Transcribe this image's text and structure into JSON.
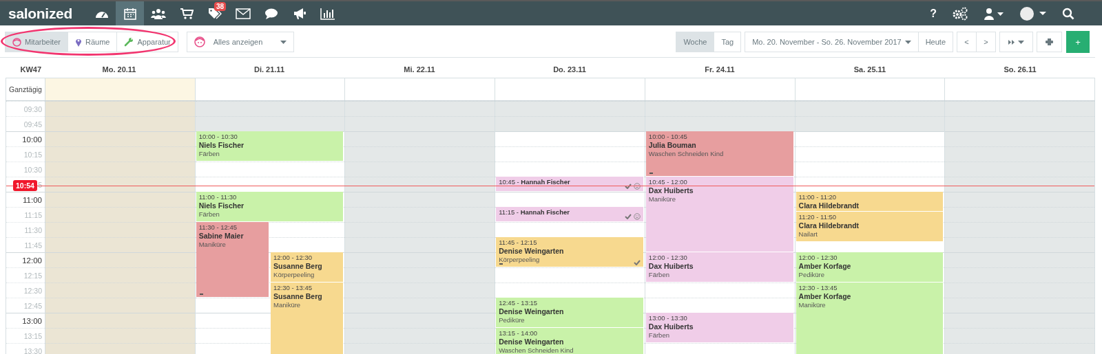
{
  "navbar": {
    "logo": "salonized",
    "items": [
      {
        "kind": "dashboard",
        "selected": false
      },
      {
        "kind": "calendar",
        "selected": true
      },
      {
        "kind": "customers",
        "selected": false
      },
      {
        "kind": "cart",
        "selected": false
      },
      {
        "kind": "tags",
        "selected": false,
        "badge": "38"
      },
      {
        "kind": "mail",
        "selected": false
      },
      {
        "kind": "chat",
        "selected": false
      },
      {
        "kind": "megaphone",
        "selected": false
      },
      {
        "kind": "reports",
        "selected": false
      }
    ],
    "help": "?"
  },
  "toolbar": {
    "resource_tabs": [
      {
        "kind": "person",
        "label": "Mitarbeiter",
        "selected": true
      },
      {
        "kind": "pin",
        "label": "Räume",
        "selected": false
      },
      {
        "kind": "wrench",
        "label": "Apparatur",
        "selected": false
      }
    ],
    "filter": {
      "label": "Alles anzeigen"
    },
    "view_tabs": [
      {
        "label": "Woche",
        "selected": true
      },
      {
        "label": "Tag",
        "selected": false
      }
    ],
    "date_range": "Mo. 20. November - So. 26. November 2017",
    "today": "Heute",
    "prev": "<",
    "next": ">",
    "add": "+"
  },
  "calendar": {
    "week": "KW47",
    "all_day": "Ganztägig",
    "now": "10:54",
    "slots": [
      {
        "label": "09:30",
        "major": false,
        "business_hours": false
      },
      {
        "label": "09:45",
        "major": false,
        "business_hours": false
      },
      {
        "label": "10:00",
        "major": true,
        "business_hours": true
      },
      {
        "label": "10:15",
        "major": false,
        "business_hours": true
      },
      {
        "label": "10:30",
        "major": false,
        "business_hours": true
      },
      {
        "label": "5",
        "major": false,
        "business_hours": true
      },
      {
        "label": "11:00",
        "major": true,
        "business_hours": true
      },
      {
        "label": "11:15",
        "major": false,
        "business_hours": true
      },
      {
        "label": "11:30",
        "major": false,
        "business_hours": true
      },
      {
        "label": "11:45",
        "major": false,
        "business_hours": true
      },
      {
        "label": "12:00",
        "major": true,
        "business_hours": true
      },
      {
        "label": "12:15",
        "major": false,
        "business_hours": true
      },
      {
        "label": "12:30",
        "major": false,
        "business_hours": true
      },
      {
        "label": "12:45",
        "major": false,
        "business_hours": true
      },
      {
        "label": "13:00",
        "major": true,
        "business_hours": true
      },
      {
        "label": "13:15",
        "major": false,
        "business_hours": true
      },
      {
        "label": "13:30",
        "major": false,
        "business_hours": true
      }
    ],
    "days": [
      {
        "label": "Mo. 20.11",
        "past": true,
        "closed": false
      },
      {
        "label": "Di. 21.11",
        "past": false,
        "closed": false,
        "events": [
          {
            "kind": "full",
            "color": "#c9f2a9",
            "time": "10:00 - 10:30",
            "name": "Niels Fischer",
            "service": "Färben",
            "confirmed": false,
            "unhappy": false,
            "note": false
          },
          {
            "kind": "full",
            "color": "#c9f2a9",
            "time": "11:00 - 11:30",
            "name": "Niels Fischer",
            "service": "Färben",
            "confirmed": false,
            "unhappy": false,
            "note": false
          },
          {
            "kind": "full",
            "color": "#e79e9f",
            "time": "11:30 - 12:45",
            "name": "Sabine Maier",
            "service": "Maniküre",
            "confirmed": false,
            "unhappy": false,
            "note": true
          },
          {
            "kind": "full",
            "color": "#f7d98f",
            "time": "12:00 - 12:30",
            "name": "Susanne Berg",
            "service": "Körperpeeling",
            "confirmed": false,
            "unhappy": false,
            "note": false
          },
          {
            "kind": "full",
            "color": "#f7d98f",
            "time": "12:30 - 13:45",
            "name": "Susanne Berg",
            "service": "Maniküre",
            "confirmed": false,
            "unhappy": false,
            "note": false
          }
        ]
      },
      {
        "label": "Mi. 22.11",
        "past": false,
        "closed": true
      },
      {
        "label": "Do. 23.11",
        "past": false,
        "closed": false,
        "events": [
          {
            "kind": "compact",
            "color": "#f0cde8",
            "title": "10:45 - **Hannah Fischer**",
            "confirmed": true,
            "unhappy": true,
            "note": false
          },
          {
            "kind": "compact",
            "color": "#f0cde8",
            "title": "11:15 - **Hannah Fischer**",
            "confirmed": true,
            "unhappy": true,
            "note": false
          },
          {
            "kind": "full",
            "color": "#f7d98f",
            "time": "11:45 - 12:15",
            "name": "Denise Weingarten",
            "service": "Körperpeeling",
            "confirmed": true,
            "unhappy": false,
            "note": true
          },
          {
            "kind": "full",
            "color": "#c9f2a9",
            "time": "12:45 - 13:15",
            "name": "Denise Weingarten",
            "service": "Pediküre",
            "confirmed": false,
            "unhappy": false,
            "note": false
          },
          {
            "kind": "full",
            "color": "#c9f2a9",
            "time": "13:15 - 14:00",
            "name": "Denise Weingarten",
            "service": "Waschen Schneiden Kind",
            "confirmed": false,
            "unhappy": false,
            "note": false
          }
        ]
      },
      {
        "label": "Fr. 24.11",
        "past": false,
        "closed": false,
        "events": [
          {
            "kind": "full",
            "color": "#e79e9f",
            "time": "10:00 - 10:45",
            "name": "Julia Bouman",
            "service": "Waschen Schneiden Kind",
            "confirmed": false,
            "unhappy": false,
            "note": true
          },
          {
            "kind": "full",
            "color": "#f0cde8",
            "time": "10:45 - 12:00",
            "name": "Dax Huiberts",
            "service": "Maniküre",
            "confirmed": false,
            "unhappy": false,
            "note": false
          },
          {
            "kind": "full",
            "color": "#f0cde8",
            "time": "12:00 - 12:30",
            "name": "Dax Huiberts",
            "service": "Färben",
            "confirmed": false,
            "unhappy": false,
            "note": false
          },
          {
            "kind": "full",
            "color": "#f0cde8",
            "time": "13:00 - 13:30",
            "name": "Dax Huiberts",
            "service": "Färben",
            "confirmed": false,
            "unhappy": false,
            "note": false
          }
        ]
      },
      {
        "label": "Sa. 25.11",
        "past": false,
        "closed": false,
        "events": [
          {
            "kind": "full",
            "color": "#f7d98f",
            "time": "11:00 - 11:20",
            "name": "Clara Hildebrandt",
            "confirmed": false,
            "unhappy": false,
            "note": false
          },
          {
            "kind": "full",
            "color": "#f7d98f",
            "time": "11:20 - 11:50",
            "name": "Clara Hildebrandt",
            "service": "Nailart",
            "confirmed": false,
            "unhappy": false,
            "note": false
          },
          {
            "kind": "full",
            "color": "#c9f2a9",
            "time": "12:00 - 12:30",
            "name": "Amber Korfage",
            "service": "Pediküre",
            "confirmed": false,
            "unhappy": false,
            "note": false
          },
          {
            "kind": "full",
            "color": "#c9f2a9",
            "time": "12:30 - 13:45",
            "name": "Amber Korfage",
            "service": "Maniküre",
            "confirmed": false,
            "unhappy": false,
            "note": false
          }
        ]
      },
      {
        "label": "So. 26.11",
        "past": false,
        "closed": true
      }
    ]
  }
}
